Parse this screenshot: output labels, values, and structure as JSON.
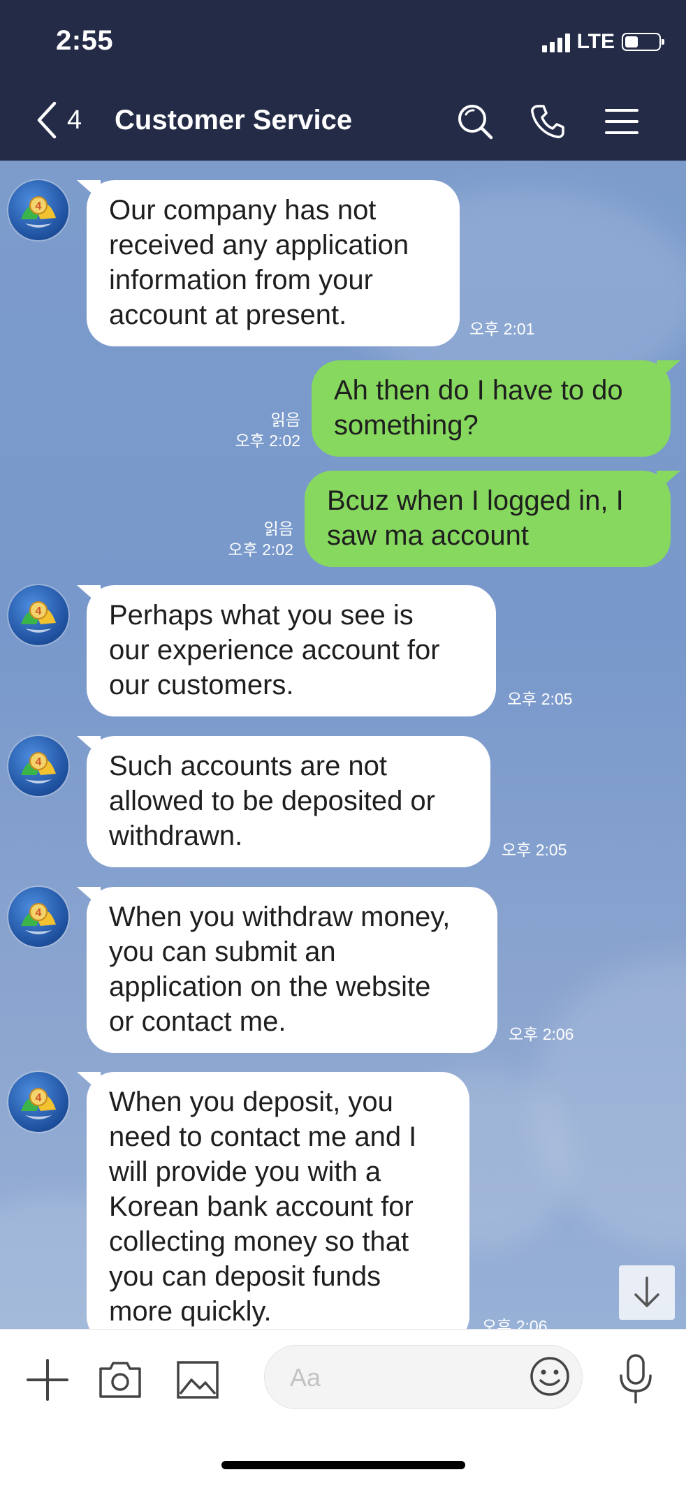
{
  "status_bar": {
    "time": "2:55",
    "network": "LTE"
  },
  "header": {
    "back_count": "4",
    "title": "Customer Service"
  },
  "messages": [
    {
      "direction": "in",
      "lines": [
        "Our company has not",
        "received any application",
        "information from your",
        "account at present."
      ],
      "time": "오후 2:01"
    },
    {
      "direction": "out",
      "lines": [
        "Ah then do I have to do",
        "something?"
      ],
      "read": "읽음",
      "time": "오후 2:02"
    },
    {
      "direction": "out",
      "lines": [
        "Bcuz when I logged in, I",
        "saw ma account"
      ],
      "read": "읽음",
      "time": "오후 2:02"
    },
    {
      "direction": "in",
      "lines": [
        "Perhaps what you see is",
        "our experience account for",
        "our customers."
      ],
      "time": "오후 2:05"
    },
    {
      "direction": "in",
      "lines": [
        "Such accounts are not",
        "allowed to be deposited or",
        "withdrawn."
      ],
      "time": "오후 2:05"
    },
    {
      "direction": "in",
      "lines": [
        "When you withdraw money,",
        "you can submit an",
        "application on the website",
        "or contact me."
      ],
      "time": "오후 2:06"
    },
    {
      "direction": "in",
      "lines": [
        "When you deposit, you",
        "need to contact me and I",
        "will provide you with a",
        "Korean bank account for",
        "collecting money so that",
        "you can deposit funds",
        "more quickly."
      ],
      "time": "오후 2:06"
    }
  ],
  "input": {
    "placeholder": "Aa"
  },
  "colors": {
    "header_bg": "#232b47",
    "chat_bg": "#7d9ccc",
    "incoming_bubble": "#ffffff",
    "outgoing_bubble": "#86d85e"
  },
  "icons": {
    "header": [
      "back-chevron-icon",
      "search-icon",
      "phone-icon",
      "menu-icon"
    ],
    "input_bar": [
      "plus-icon",
      "camera-icon",
      "image-icon",
      "emoji-icon",
      "microphone-icon"
    ],
    "chat": [
      "scroll-down-arrow-icon"
    ]
  }
}
